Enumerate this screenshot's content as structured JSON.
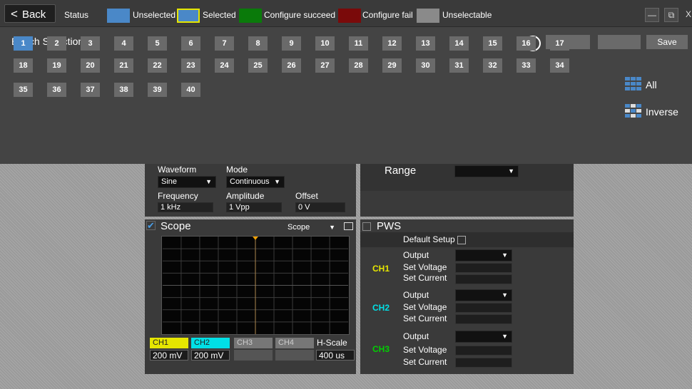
{
  "topbar": {
    "back_label": "Back",
    "status_label": "Status",
    "legend": [
      {
        "label": "Unselected",
        "color": "#4a88c8"
      },
      {
        "label": "Selected",
        "color": "#4a88c8"
      },
      {
        "label": "Configure succeed",
        "color": "#0a7a0a"
      },
      {
        "label": "Configure fail",
        "color": "#7a0a0a"
      },
      {
        "label": "Unselectable",
        "color": "#8a8a8a"
      }
    ],
    "min_label": "—",
    "restore_label": "⧉",
    "close_label": "X"
  },
  "bench": {
    "title": "Bench Selection",
    "save_label": "Save",
    "all_label": "All",
    "inverse_label": "Inverse",
    "selected": [
      1
    ],
    "buttons": [
      "1",
      "2",
      "3",
      "4",
      "5",
      "6",
      "7",
      "8",
      "9",
      "10",
      "11",
      "12",
      "13",
      "14",
      "15",
      "16",
      "17",
      "18",
      "19",
      "20",
      "21",
      "22",
      "23",
      "24",
      "25",
      "26",
      "27",
      "28",
      "29",
      "30",
      "31",
      "32",
      "33",
      "34",
      "35",
      "36",
      "37",
      "38",
      "39",
      "40"
    ]
  },
  "fg": {
    "waveform_label": "Waveform",
    "waveform_value": "Sine",
    "mode_label": "Mode",
    "mode_value": "Continuous",
    "frequency_label": "Frequency",
    "frequency_value": "1 kHz",
    "amplitude_label": "Amplitude",
    "amplitude_value": "1 Vpp",
    "offset_label": "Offset",
    "offset_value": "0 V"
  },
  "range": {
    "label": "Range",
    "value": ""
  },
  "scope": {
    "title": "Scope",
    "mode_value": "Scope",
    "channels": [
      {
        "label": "CH1",
        "value": "200 mV",
        "color": "#e6e600"
      },
      {
        "label": "CH2",
        "value": "200 mV",
        "color": "#00e0e6"
      },
      {
        "label": "CH3",
        "value": "",
        "color": "#777777"
      },
      {
        "label": "CH4",
        "value": "",
        "color": "#777777"
      }
    ],
    "hscale_label": "H-Scale",
    "hscale_value": "400 us"
  },
  "pws": {
    "title": "PWS",
    "default_setup_label": "Default Setup",
    "channels": [
      {
        "label": "CH1",
        "color": "#e6e600",
        "output_label": "Output",
        "voltage_label": "Set Voltage",
        "current_label": "Set Current"
      },
      {
        "label": "CH2",
        "color": "#00e0e6",
        "output_label": "Output",
        "voltage_label": "Set Voltage",
        "current_label": "Set Current"
      },
      {
        "label": "CH3",
        "color": "#00d000",
        "output_label": "Output",
        "voltage_label": "Set Voltage",
        "current_label": "Set Current"
      }
    ]
  }
}
